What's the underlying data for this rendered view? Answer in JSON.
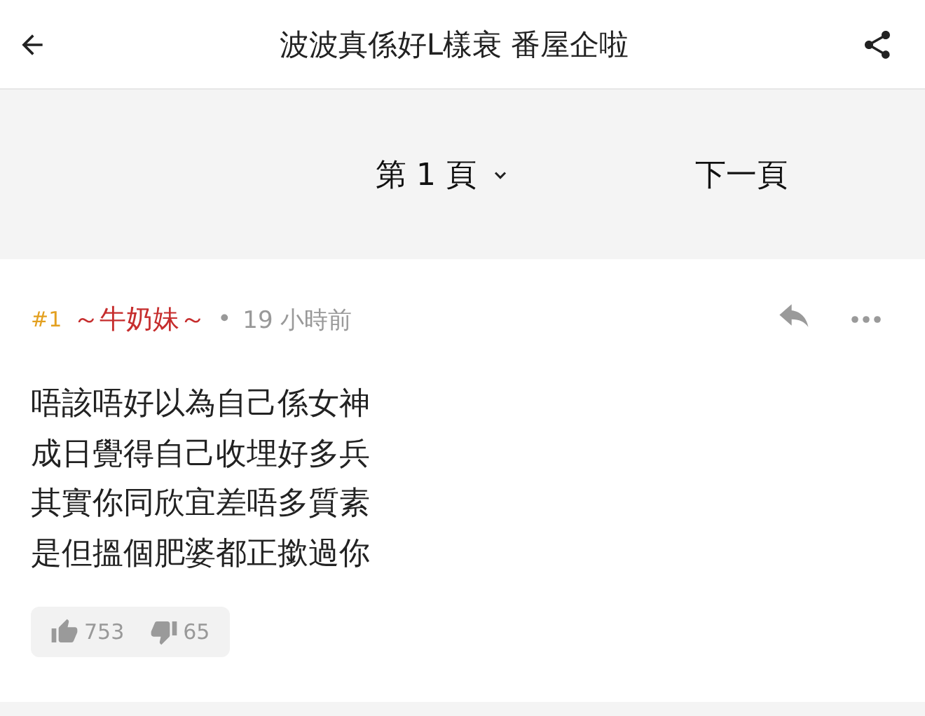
{
  "header": {
    "title": "波波真係好L樣衰 番屋企啦"
  },
  "pager": {
    "current": "第 1 頁",
    "next": "下一頁"
  },
  "post": {
    "number": "#1",
    "author": "～牛奶妹～",
    "separator": "•",
    "time": "19 小時前",
    "lines": [
      "唔該唔好以為自己係女神",
      "成日覺得自己收埋好多兵",
      "其實你同欣宜差唔多質素",
      "是但搵個肥婆都正撳過你"
    ],
    "likes": "753",
    "dislikes": "65"
  }
}
